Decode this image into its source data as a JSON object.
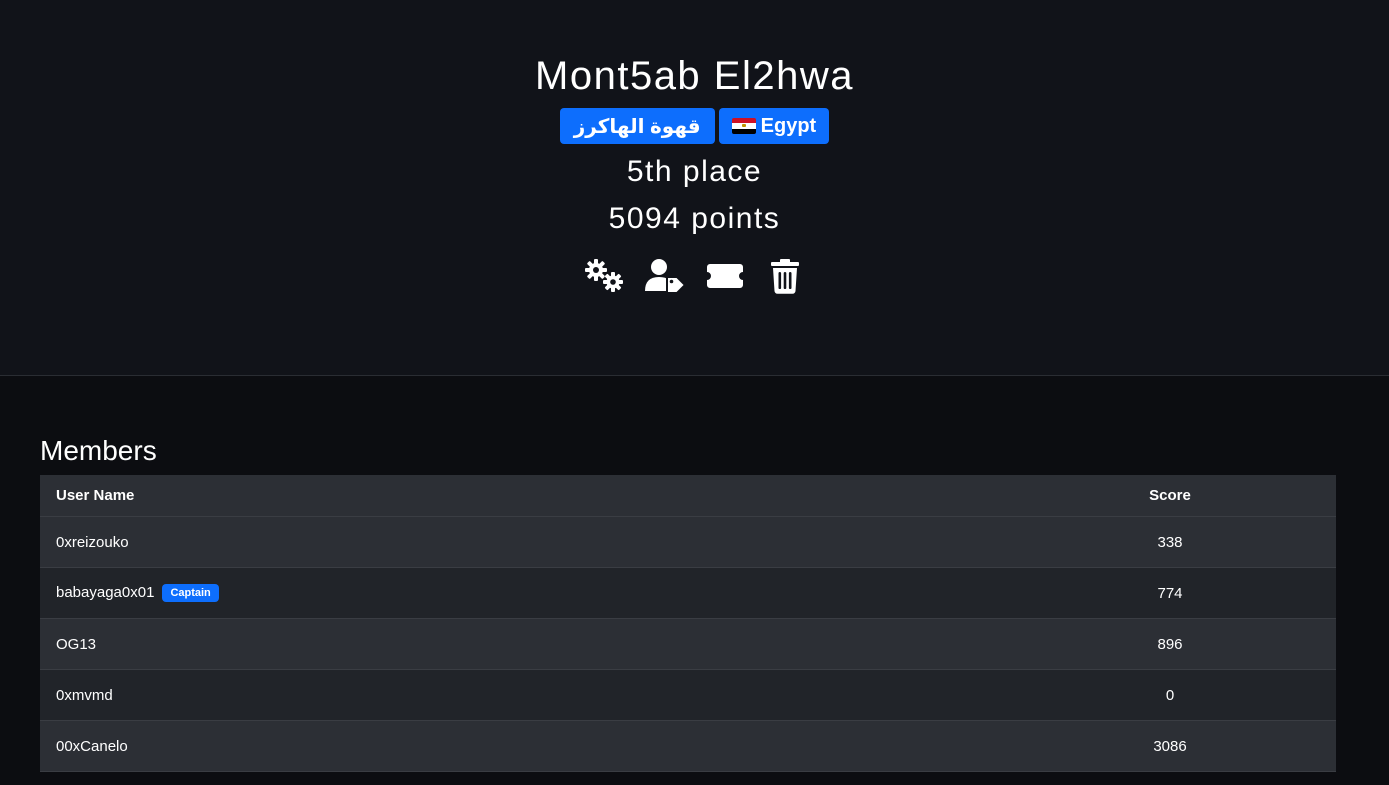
{
  "team": {
    "name": "Mont5ab El2hwa",
    "affiliation": "قهوة الهاكرز",
    "country": "Egypt",
    "place": "5th place",
    "points": "5094 points"
  },
  "colors": {
    "badge": "#0d6efd",
    "hero_bg": "#111319",
    "page_bg": "#0c0d11"
  },
  "actions": [
    {
      "icon": "gears-icon"
    },
    {
      "icon": "user-tag-icon"
    },
    {
      "icon": "ticket-icon"
    },
    {
      "icon": "trash-icon"
    }
  ],
  "members": {
    "title": "Members",
    "columns": {
      "user": "User Name",
      "score": "Score"
    },
    "rows": [
      {
        "user": "0xreizouko",
        "score": "338"
      },
      {
        "user": "babayaga0x01",
        "score": "774",
        "badge": "Captain"
      },
      {
        "user": "OG13",
        "score": "896"
      },
      {
        "user": "0xmvmd",
        "score": "0"
      },
      {
        "user": "00xCanelo",
        "score": "3086"
      }
    ]
  }
}
